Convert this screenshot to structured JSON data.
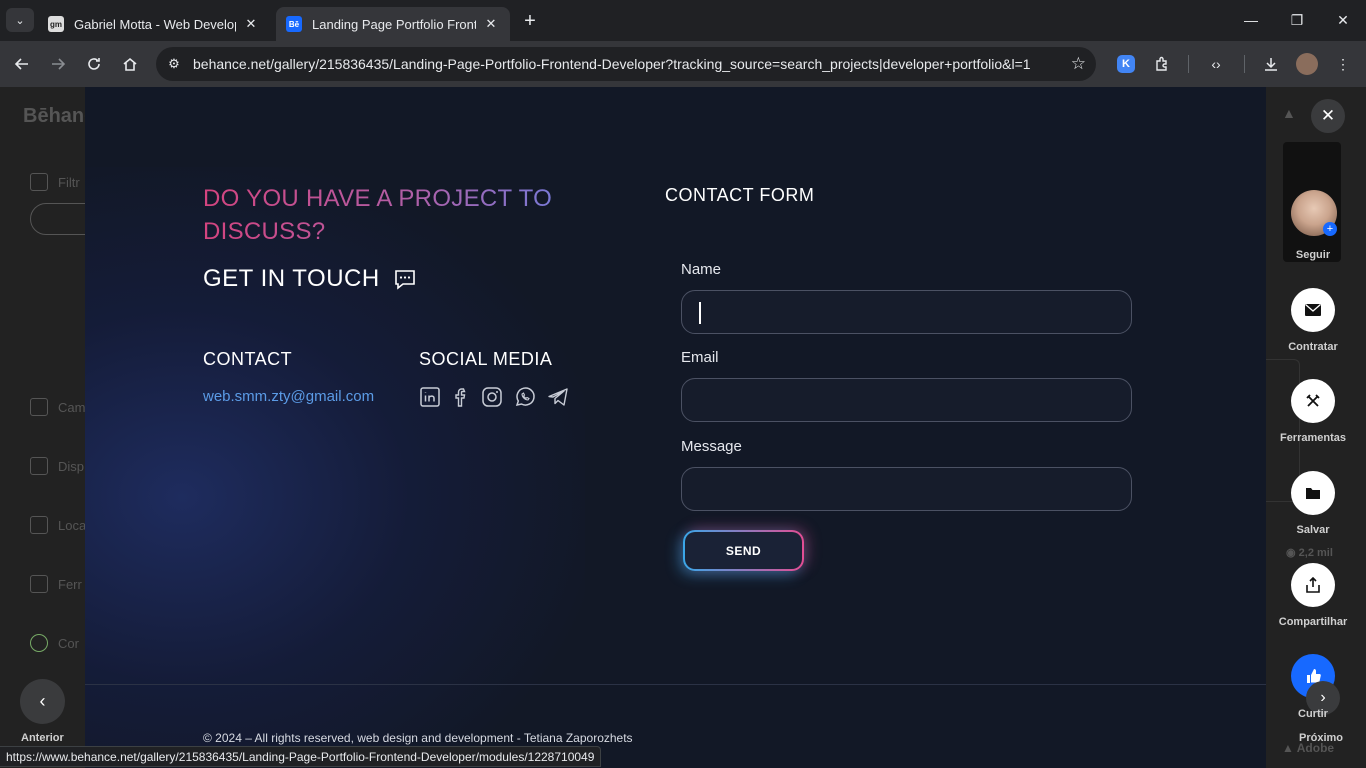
{
  "browser": {
    "tabs": [
      {
        "favicon": "gm",
        "title": "Gabriel Motta - Web Developer"
      },
      {
        "favicon": "Bē",
        "title": "Landing Page Portfolio Frontend"
      }
    ],
    "url": "behance.net/gallery/215836435/Landing-Page-Portfolio-Frontend-Developer?tracking_source=search_projects|developer+portfolio&l=1",
    "extension_k": "K",
    "status_url": "https://www.behance.net/gallery/215836435/Landing-Page-Portfolio-Frontend-Developer/modules/1228710049"
  },
  "background": {
    "logo": "Bēhance",
    "filter_label": "Filtr",
    "side_items": [
      "Cam",
      "Disp",
      "Loca",
      "Ferr",
      "Cor"
    ]
  },
  "project": {
    "headline": "DO YOU HAVE A PROJECT TO DISCUSS?",
    "get_in_touch": "GET IN TOUCH",
    "contact_heading": "CONTACT",
    "contact_email": "web.smm.zty@gmail.com",
    "social_heading": "SOCIAL MEDIA",
    "social_icons": [
      "linkedin-icon",
      "facebook-icon",
      "instagram-icon",
      "whatsapp-icon",
      "telegram-icon"
    ],
    "form_heading": "CONTACT FORM",
    "form": {
      "name_label": "Name",
      "name_value": "",
      "email_label": "Email",
      "email_value": "",
      "message_label": "Message",
      "message_value": "",
      "send_label": "SEND"
    },
    "copyright": "© 2024 – All rights reserved, web design and development - Tetiana Zaporozhets"
  },
  "rail": {
    "follow_label": "Seguir",
    "hire_label": "Contratar",
    "tools_label": "Ferramentas",
    "save_label": "Salvar",
    "share_label": "Compartilhar",
    "like_label": "Curtir",
    "next_label": "Próximo",
    "prev_label": "Anterior",
    "views": "2,2 mil",
    "adobe": "Adobe"
  },
  "colors": {
    "modal_bg": "#121826",
    "accent_pink": "#d4447f",
    "accent_blue": "#6e7ee0",
    "link_blue": "#5b9be6",
    "behance_blue": "#1769ff"
  }
}
